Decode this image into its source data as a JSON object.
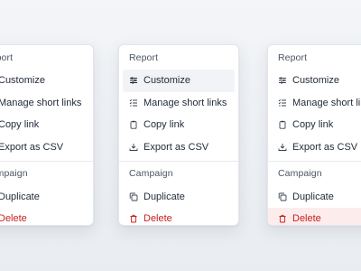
{
  "colors": {
    "danger": "#c81e1e",
    "danger_bg": "#fdecec",
    "hover_bg": "#f1f3f6",
    "text": "#1f2937",
    "muted": "#4b5563"
  },
  "menus": [
    {
      "state": "default",
      "report_title": "Report",
      "report_items": [
        {
          "label": "Customize",
          "icon": "sliders-icon"
        },
        {
          "label": "Manage short links",
          "icon": "list-icon"
        },
        {
          "label": "Copy link",
          "icon": "clipboard-icon"
        },
        {
          "label": "Export as CSV",
          "icon": "download-icon"
        }
      ],
      "campaign_title": "Campaign",
      "campaign_items": [
        {
          "label": "Duplicate",
          "icon": "copy-icon"
        },
        {
          "label": "Delete",
          "icon": "trash-icon"
        }
      ]
    },
    {
      "state": "customize-hovered",
      "report_title": "Report",
      "report_items": [
        {
          "label": "Customize",
          "icon": "sliders-icon"
        },
        {
          "label": "Manage short links",
          "icon": "list-icon"
        },
        {
          "label": "Copy link",
          "icon": "clipboard-icon"
        },
        {
          "label": "Export as CSV",
          "icon": "download-icon"
        }
      ],
      "campaign_title": "Campaign",
      "campaign_items": [
        {
          "label": "Duplicate",
          "icon": "copy-icon"
        },
        {
          "label": "Delete",
          "icon": "trash-icon"
        }
      ]
    },
    {
      "state": "delete-hovered",
      "report_title": "Report",
      "report_items": [
        {
          "label": "Customize",
          "icon": "sliders-icon"
        },
        {
          "label": "Manage short links",
          "icon": "list-icon"
        },
        {
          "label": "Copy link",
          "icon": "clipboard-icon"
        },
        {
          "label": "Export as CSV",
          "icon": "download-icon"
        }
      ],
      "campaign_title": "Campaign",
      "campaign_items": [
        {
          "label": "Duplicate",
          "icon": "copy-icon"
        },
        {
          "label": "Delete",
          "icon": "trash-icon"
        }
      ]
    }
  ]
}
